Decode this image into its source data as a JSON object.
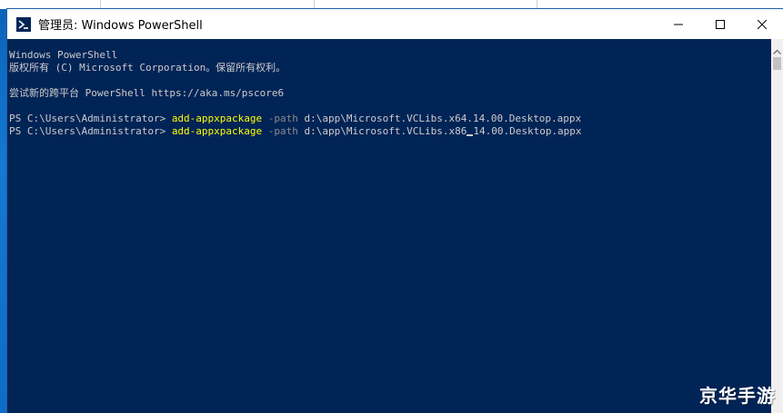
{
  "window": {
    "title": "管理员: Windows PowerShell",
    "icon": "powershell-icon",
    "controls": {
      "minimize": "minimize-icon",
      "maximize": "maximize-icon",
      "close": "close-icon"
    }
  },
  "console": {
    "header_line1": "Windows PowerShell",
    "header_line2": "版权所有 (C) Microsoft Corporation。保留所有权利。",
    "tip_line": "尝试新的跨平台 PowerShell https://aka.ms/pscore6",
    "commands": [
      {
        "prompt": "PS C:\\Users\\Administrator> ",
        "cmdlet": "add-appxpackage",
        "param": "-path",
        "arg": "d:\\app\\Microsoft.VCLibs.x64.14.00.Desktop.appx"
      },
      {
        "prompt": "PS C:\\Users\\Administrator> ",
        "cmdlet": "add-appxpackage",
        "param": "-path",
        "arg_before_cursor": "d:\\app\\Microsoft.VCLibs.x86",
        "arg_after_cursor": "14.00.Desktop.appx"
      }
    ]
  },
  "watermark": "京华手游",
  "colors": {
    "console_bg": "#012456",
    "cmdlet": "#ffff00",
    "param": "#8a8a8a",
    "text": "#cccccc"
  }
}
